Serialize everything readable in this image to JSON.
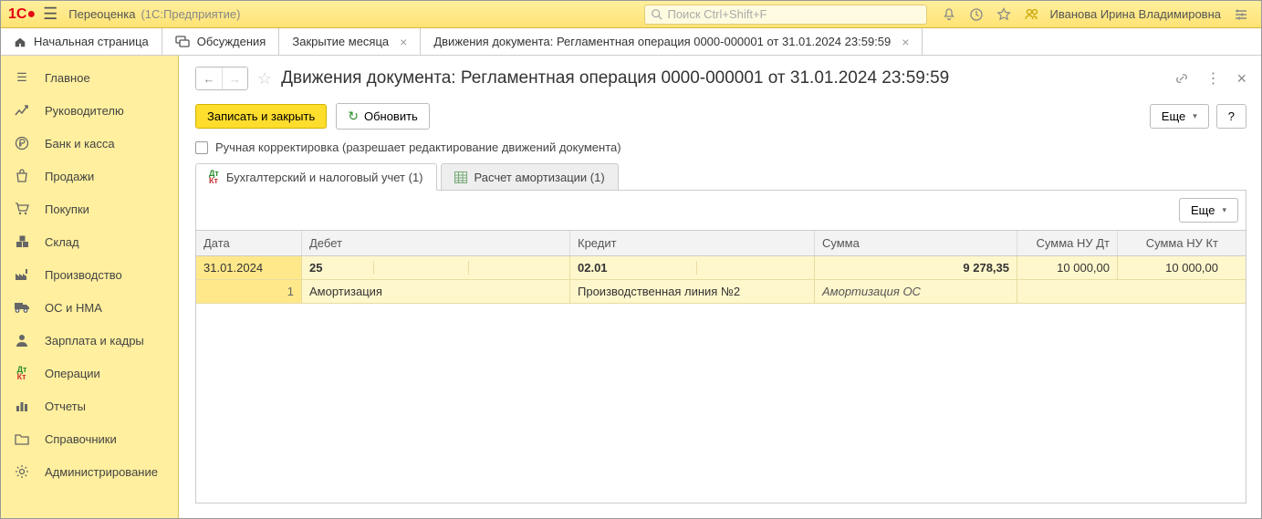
{
  "topbar": {
    "app_title": "Переоценка",
    "app_sub": "(1С:Предприятие)",
    "search_placeholder": "Поиск Ctrl+Shift+F",
    "user_name": "Иванова Ирина Владимировна"
  },
  "maintabs": [
    {
      "label": "Начальная страница",
      "closable": false
    },
    {
      "label": "Обсуждения",
      "closable": false
    },
    {
      "label": "Закрытие месяца",
      "closable": true
    },
    {
      "label": "Движения документа: Регламентная операция 0000-000001 от 31.01.2024 23:59:59",
      "closable": true
    }
  ],
  "sidebar": [
    "Главное",
    "Руководителю",
    "Банк и касса",
    "Продажи",
    "Покупки",
    "Склад",
    "Производство",
    "ОС и НМА",
    "Зарплата и кадры",
    "Операции",
    "Отчеты",
    "Справочники",
    "Администрирование"
  ],
  "page": {
    "title": "Движения документа: Регламентная операция 0000-000001 от 31.01.2024 23:59:59",
    "save_close": "Записать и закрыть",
    "refresh": "Обновить",
    "more": "Еще",
    "help": "?",
    "manual_edit": "Ручная корректировка (разрешает редактирование движений документа)"
  },
  "subtabs": [
    "Бухгалтерский и налоговый учет (1)",
    "Расчет амортизации (1)"
  ],
  "grid": {
    "headers": {
      "date": "Дата",
      "debit": "Дебет",
      "credit": "Кредит",
      "sum": "Сумма",
      "nudt": "Сумма НУ Дт",
      "nukt": "Сумма НУ Кт"
    },
    "row1": {
      "date": "31.01.2024",
      "debit": "25",
      "credit": "02.01",
      "sum": "9 278,35",
      "nudt": "10 000,00",
      "nukt": "10 000,00"
    },
    "row2": {
      "num": "1",
      "debit": "Амортизация",
      "credit": "Производственная линия №2",
      "sum": "Амортизация ОС"
    }
  }
}
